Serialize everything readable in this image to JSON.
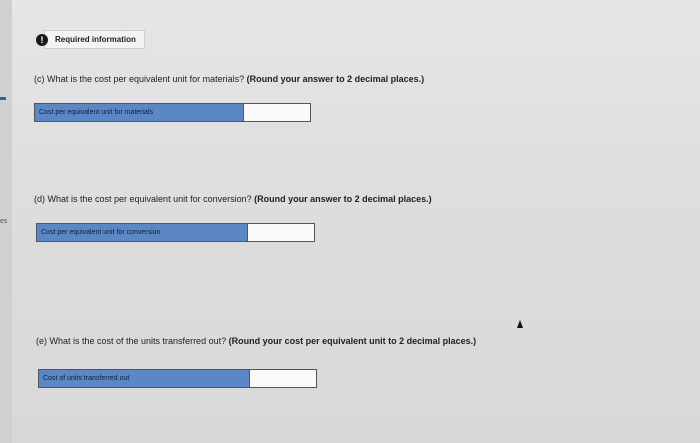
{
  "required_info": {
    "icon_glyph": "!",
    "label": "Required information"
  },
  "left_edge": {
    "text": "es"
  },
  "questions": [
    {
      "prompt": "(c) What is the cost per equivalent unit for materials?",
      "instruction": "(Round your answer to 2 decimal places.)",
      "field_label": "Cost per equivalent unit for materials",
      "field_value": ""
    },
    {
      "prompt": "(d) What is the cost per equivalent unit for conversion?",
      "instruction": "(Round your answer to 2 decimal places.)",
      "field_label": "Cost per equivalent unit for conversion",
      "field_value": ""
    },
    {
      "prompt": "(e) What is the cost of the units transferred out?",
      "instruction": "(Round your cost per equivalent unit to 2 decimal places.)",
      "field_label": "Cost of units transferred out",
      "field_value": ""
    }
  ],
  "colors": {
    "label_bg": "#5b87c5",
    "page_bg": "#e2e2e2"
  }
}
